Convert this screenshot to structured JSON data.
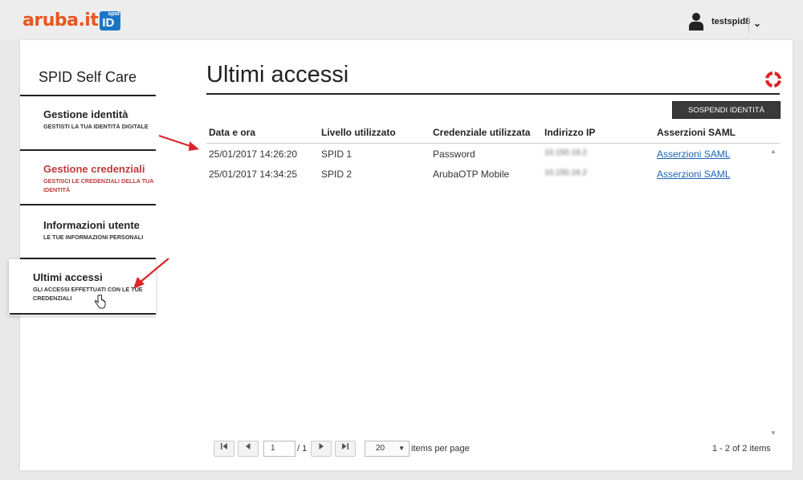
{
  "header": {
    "logo_text": "aruba.it",
    "logo_badge_small": "spid",
    "logo_badge_large": "ID",
    "username": "testspid8"
  },
  "sidebar": {
    "title": "SPID Self Care",
    "items": [
      {
        "title": "Gestione identità",
        "desc": "Gestisti la tua identità digitale"
      },
      {
        "title": "Gestione credenziali",
        "desc": "Gestisci le credenziali della tua identità"
      },
      {
        "title": "Informazioni utente",
        "desc": "Le tue informazioni personali"
      },
      {
        "title": "Ultimi accessi",
        "desc": "Gli accessi effettuati con le tue credenziali"
      }
    ]
  },
  "main": {
    "title": "Ultimi accessi",
    "suspend_button": "Sospendi identità"
  },
  "table": {
    "columns": [
      "Data e ora",
      "Livello utilizzato",
      "Credenziale utilizzata",
      "Indirizzo IP",
      "Asserzioni SAML"
    ],
    "rows": [
      [
        "25/01/2017 14:26:20",
        "SPID 1",
        "Password",
        "10.150.19.2",
        "Asserzioni SAML"
      ],
      [
        "25/01/2017 14:34:25",
        "SPID 2",
        "ArubaOTP Mobile",
        "10.150.19.2",
        "Asserzioni SAML"
      ]
    ]
  },
  "pager": {
    "current_page": "1",
    "of_pages": "/ 1",
    "page_size": "20",
    "items_per_page": "items per page",
    "count": "1 - 2 of 2 items"
  },
  "colors": {
    "brand_orange": "#e8561d",
    "spid_blue": "#1a76c5",
    "active_red": "#c0393b",
    "link_blue": "#1b63b5"
  }
}
